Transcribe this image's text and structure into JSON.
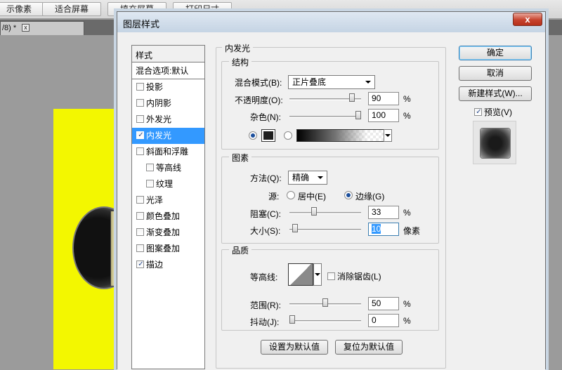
{
  "app": {
    "toolbar_buttons": [
      "示像素",
      "适合屏幕",
      "填充屏幕",
      "打印尺寸"
    ],
    "doc_tab_label": "/8) *",
    "doc_tab_close": "x"
  },
  "dialog": {
    "title": "图层样式",
    "close_label": "x",
    "styles_header": "样式",
    "blend_options": "混合选项:默认",
    "style_items": [
      {
        "label": "投影",
        "checked": false
      },
      {
        "label": "内阴影",
        "checked": false
      },
      {
        "label": "外发光",
        "checked": false
      },
      {
        "label": "内发光",
        "checked": true,
        "selected": true
      },
      {
        "label": "斜面和浮雕",
        "checked": false
      },
      {
        "label": "等高线",
        "checked": false,
        "sub": true
      },
      {
        "label": "纹理",
        "checked": false,
        "sub": true
      },
      {
        "label": "光泽",
        "checked": false
      },
      {
        "label": "颜色叠加",
        "checked": false
      },
      {
        "label": "渐变叠加",
        "checked": false
      },
      {
        "label": "图案叠加",
        "checked": false
      },
      {
        "label": "描边",
        "checked": true
      }
    ],
    "buttons": {
      "ok": "确定",
      "cancel": "取消",
      "new_style": "新建样式(W)...",
      "preview_label": "预览(V)",
      "preview_checked": true
    },
    "panel_title": "内发光",
    "structure": {
      "title": "结构",
      "blend_mode_label": "混合模式(B):",
      "blend_mode_value": "正片叠底",
      "opacity_label": "不透明度(O):",
      "opacity_value": "90",
      "opacity_level": 0.9,
      "noise_label": "杂色(N):",
      "noise_value": "100",
      "noise_level": 1.0,
      "percent": "%",
      "color_mode_selected": "solid"
    },
    "elements": {
      "title": "图素",
      "technique_label": "方法(Q):",
      "technique_value": "精确",
      "source_label": "源:",
      "source_center": "居中(E)",
      "source_edge": "边缘(G)",
      "source_selected": "edge",
      "choke_label": "阻塞(C):",
      "choke_value": "33",
      "choke_level": 0.33,
      "size_label": "大小(S):",
      "size_value": "10",
      "size_level": 0.04,
      "size_unit": "像素",
      "percent": "%"
    },
    "quality": {
      "title": "品质",
      "contour_label": "等高线:",
      "antialias_label": "消除锯齿(L)",
      "antialias_checked": false,
      "range_label": "范围(R):",
      "range_value": "50",
      "range_level": 0.5,
      "jitter_label": "抖动(J):",
      "jitter_value": "0",
      "jitter_level": 0.0,
      "percent": "%"
    },
    "footer": {
      "make_default": "设置为默认值",
      "reset_default": "复位为默认值"
    }
  }
}
